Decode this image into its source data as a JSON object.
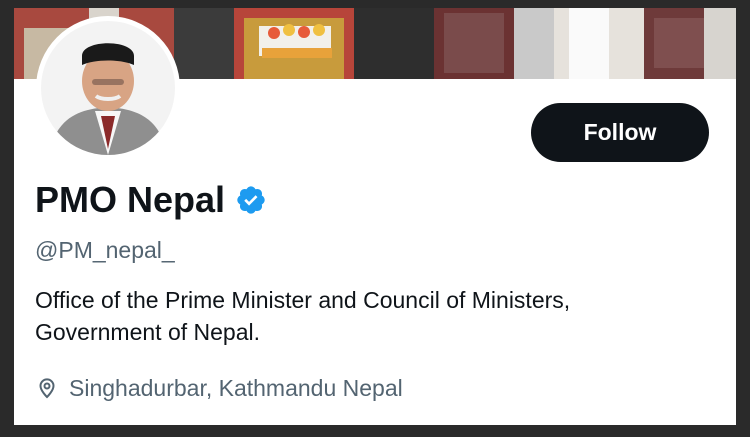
{
  "profile": {
    "display_name": "PMO Nepal",
    "handle": "@PM_nepal_",
    "bio_lines": [
      "Office of the Prime Minister and Council of Ministers,",
      "Government of Nepal."
    ],
    "location": "Singhadurbar, Kathmandu Nepal",
    "verified_icon": "verified-badge-icon",
    "location_icon": "map-pin-icon"
  },
  "actions": {
    "follow_label": "Follow"
  },
  "colors": {
    "primary_text": "#0f1419",
    "secondary_text": "#536471",
    "verified_blue": "#1d9bf0",
    "button_bg": "#0f1419",
    "button_text": "#ffffff",
    "frame_bg": "#2a2a2a"
  }
}
